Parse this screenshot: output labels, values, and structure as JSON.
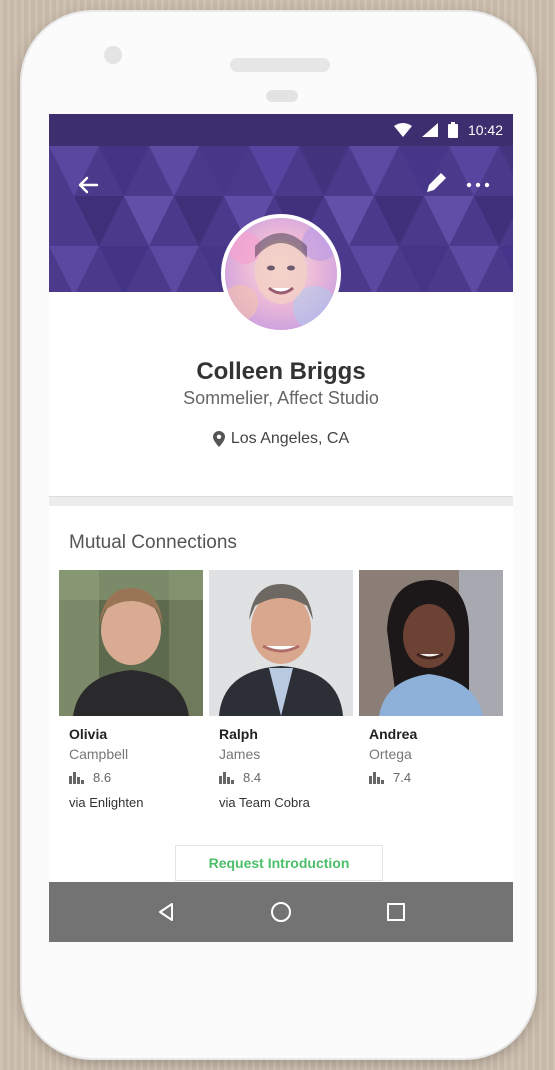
{
  "status": {
    "time": "10:42"
  },
  "profile": {
    "name": "Colleen Briggs",
    "title": "Sommelier, Affect Studio",
    "location": "Los Angeles, CA"
  },
  "mutual": {
    "heading": "Mutual Connections",
    "people": [
      {
        "first": "Olivia",
        "last": "Campbell",
        "score": "8.6",
        "via": "via Enlighten"
      },
      {
        "first": "Ralph",
        "last": "James",
        "score": "8.4",
        "via": "via Team Cobra"
      },
      {
        "first": "Andrea",
        "last": "Ortega",
        "score": "7.4",
        "via": ""
      }
    ]
  },
  "actions": {
    "request_intro": "Request Introduction"
  },
  "colors": {
    "status_bar": "#3d2f6f",
    "header": "#4b3a8c",
    "accent_green": "#4cbf6a",
    "nav_bar": "#737373"
  },
  "icons": [
    "back-arrow-icon",
    "edit-pencil-icon",
    "more-dots-icon",
    "location-pin-icon",
    "bar-chart-icon",
    "nav-back-icon",
    "nav-home-icon",
    "nav-recents-icon"
  ]
}
